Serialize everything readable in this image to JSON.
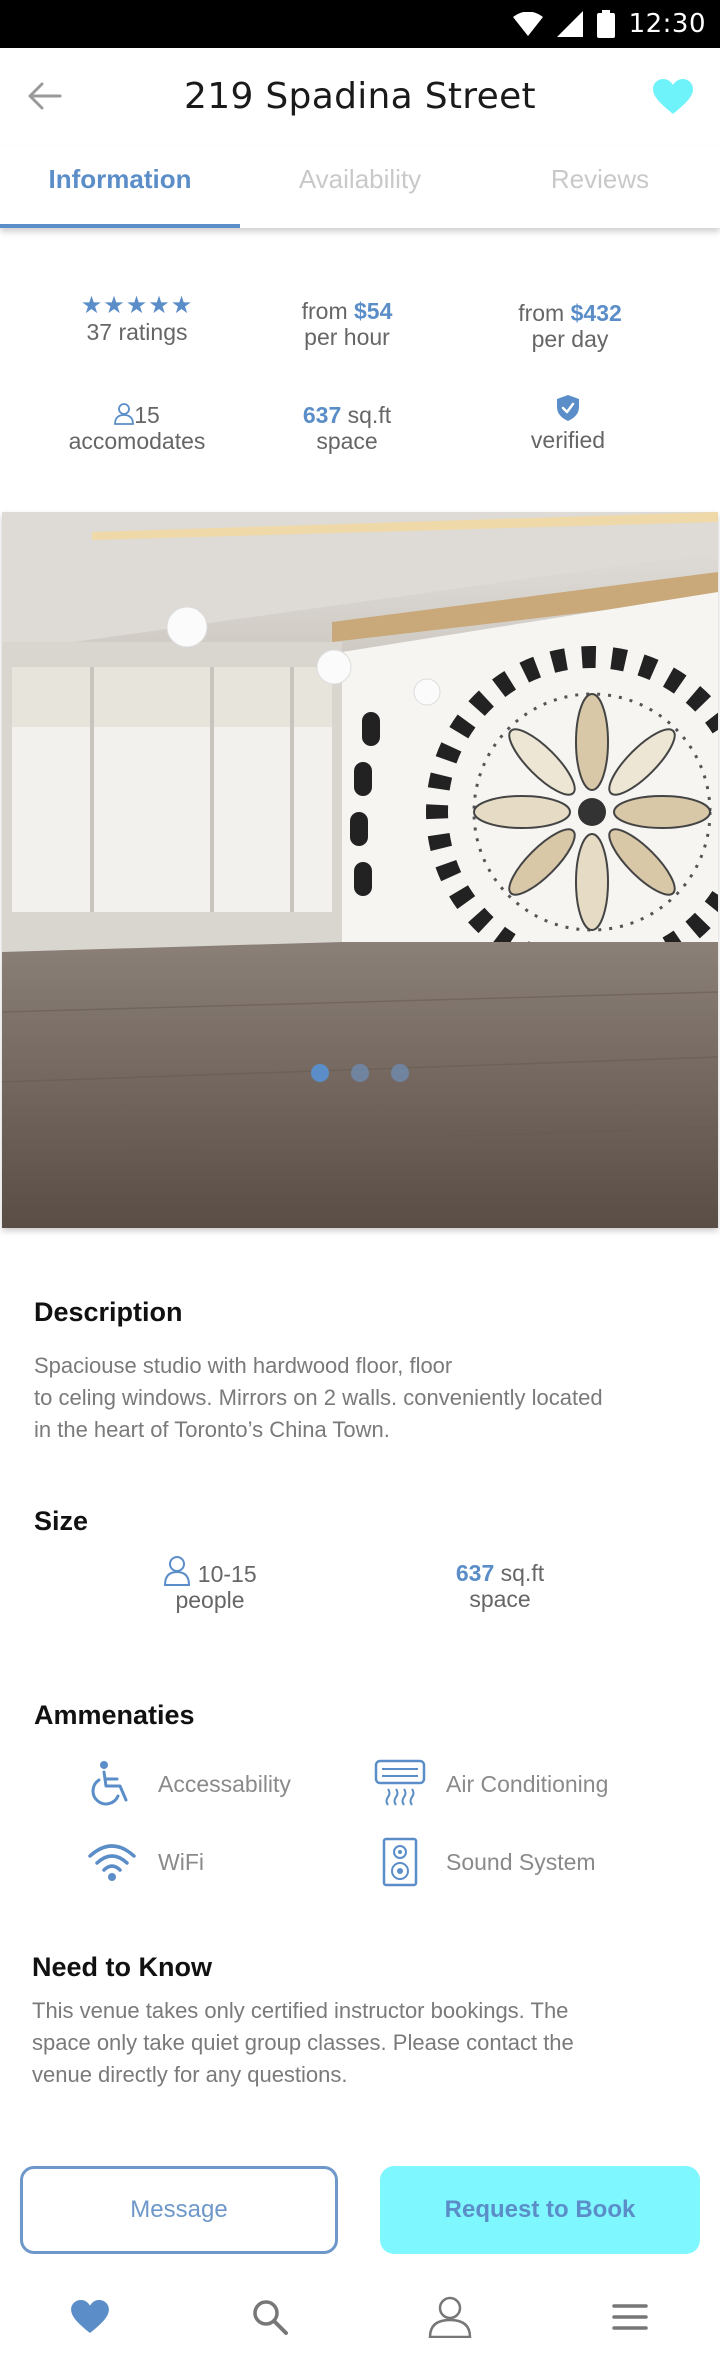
{
  "status_bar": {
    "time": "12:30",
    "icons": [
      "wifi-icon",
      "signal-icon",
      "battery-icon"
    ]
  },
  "header": {
    "title": "219 Spadina Street",
    "back_icon": "arrow-left-icon",
    "favorite_icon": "heart-icon"
  },
  "tabs": [
    {
      "label": "Information",
      "active": true
    },
    {
      "label": "Availability",
      "active": false
    },
    {
      "label": "Reviews",
      "active": false
    }
  ],
  "stats": {
    "rating_stars": "★★★★★",
    "ratings": "37 ratings",
    "hour_prefix": "from",
    "hour_price": "$54",
    "hour_unit": "per hour",
    "day_prefix": "from",
    "day_price": "$432",
    "day_unit": "per day",
    "accommodates_value": "15",
    "accommodates_label": "accomodates",
    "space_value": "637",
    "space_unit": "sq.ft",
    "space_label": "space",
    "verified_label": "verified"
  },
  "gallery": {
    "image": "studio-photo",
    "slides": 3,
    "active_slide": 1
  },
  "description": {
    "title": "Description",
    "lines": [
      "Spaciouse studio with hardwood floor, floor",
      "to celing windows. Mirrors on 2 walls. conveniently located",
      "in the heart of Toronto’s China Town."
    ]
  },
  "size": {
    "title": "Size",
    "people_value": "10-15",
    "people_label": "people",
    "space_value": "637",
    "space_unit": "sq.ft",
    "space_label": "space"
  },
  "amenities": {
    "title": "Ammenaties",
    "items": [
      {
        "label": "Accessability",
        "icon": "wheelchair-icon"
      },
      {
        "label": "Air Conditioning",
        "icon": "air-conditioner-icon"
      },
      {
        "label": "WiFi",
        "icon": "wifi-icon"
      },
      {
        "label": "Sound System",
        "icon": "speaker-icon"
      }
    ]
  },
  "need_to_know": {
    "title": "Need to Know",
    "lines": [
      "This venue takes only certified instructor bookings. The",
      "space only take quiet group classes. Please contact the",
      "venue directly for any questions."
    ]
  },
  "actions": {
    "message": "Message",
    "request": "Request to Book"
  },
  "bottom_nav": [
    "heart-icon",
    "search-icon",
    "profile-icon",
    "menu-icon"
  ],
  "colors": {
    "accent": "#5b8ec8",
    "cyan": "#7ff7ff",
    "heart": "#6ff3fb"
  }
}
